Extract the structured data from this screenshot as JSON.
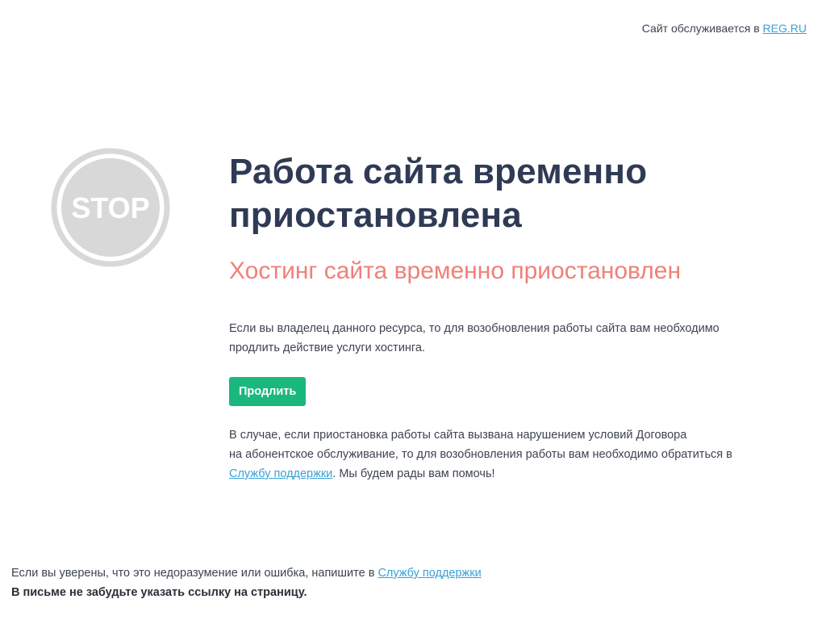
{
  "header": {
    "hosted_text": "Сайт обслуживается в",
    "hosted_link": "REG.RU"
  },
  "stop_sign": {
    "text": "STOP",
    "color": "#d8d8d8"
  },
  "main": {
    "title_line1": "Работа сайта временно",
    "title_line2": "приостановлена",
    "subtitle": "Хостинг сайта временно приостановлен",
    "owner_text_line1": "Если вы владелец данного ресурса, то для возобновления работы сайта вам необходимо",
    "owner_text_line2": "продлить действие услуги хостинга.",
    "renew_button": "Продлить",
    "violation_line1": "В случае, если приостановка работы сайта вызвана нарушением условий Договора",
    "violation_line2": "на абонентское обслуживание, то для возобновления работы вам необходимо обратиться в",
    "support_link": "Службу поддержки",
    "violation_tail": ". Мы будем рады вам помочь!"
  },
  "footer": {
    "mistake_text": "Если вы уверены, что это недоразумение или ошибка, напишите в",
    "support_link": "Службу поддержки",
    "reminder": "В письме не забудьте указать ссылку на страницу."
  },
  "colors": {
    "title": "#2f3a55",
    "subtitle": "#f08078",
    "button": "#1ab87d",
    "link": "#3aa0d6"
  }
}
